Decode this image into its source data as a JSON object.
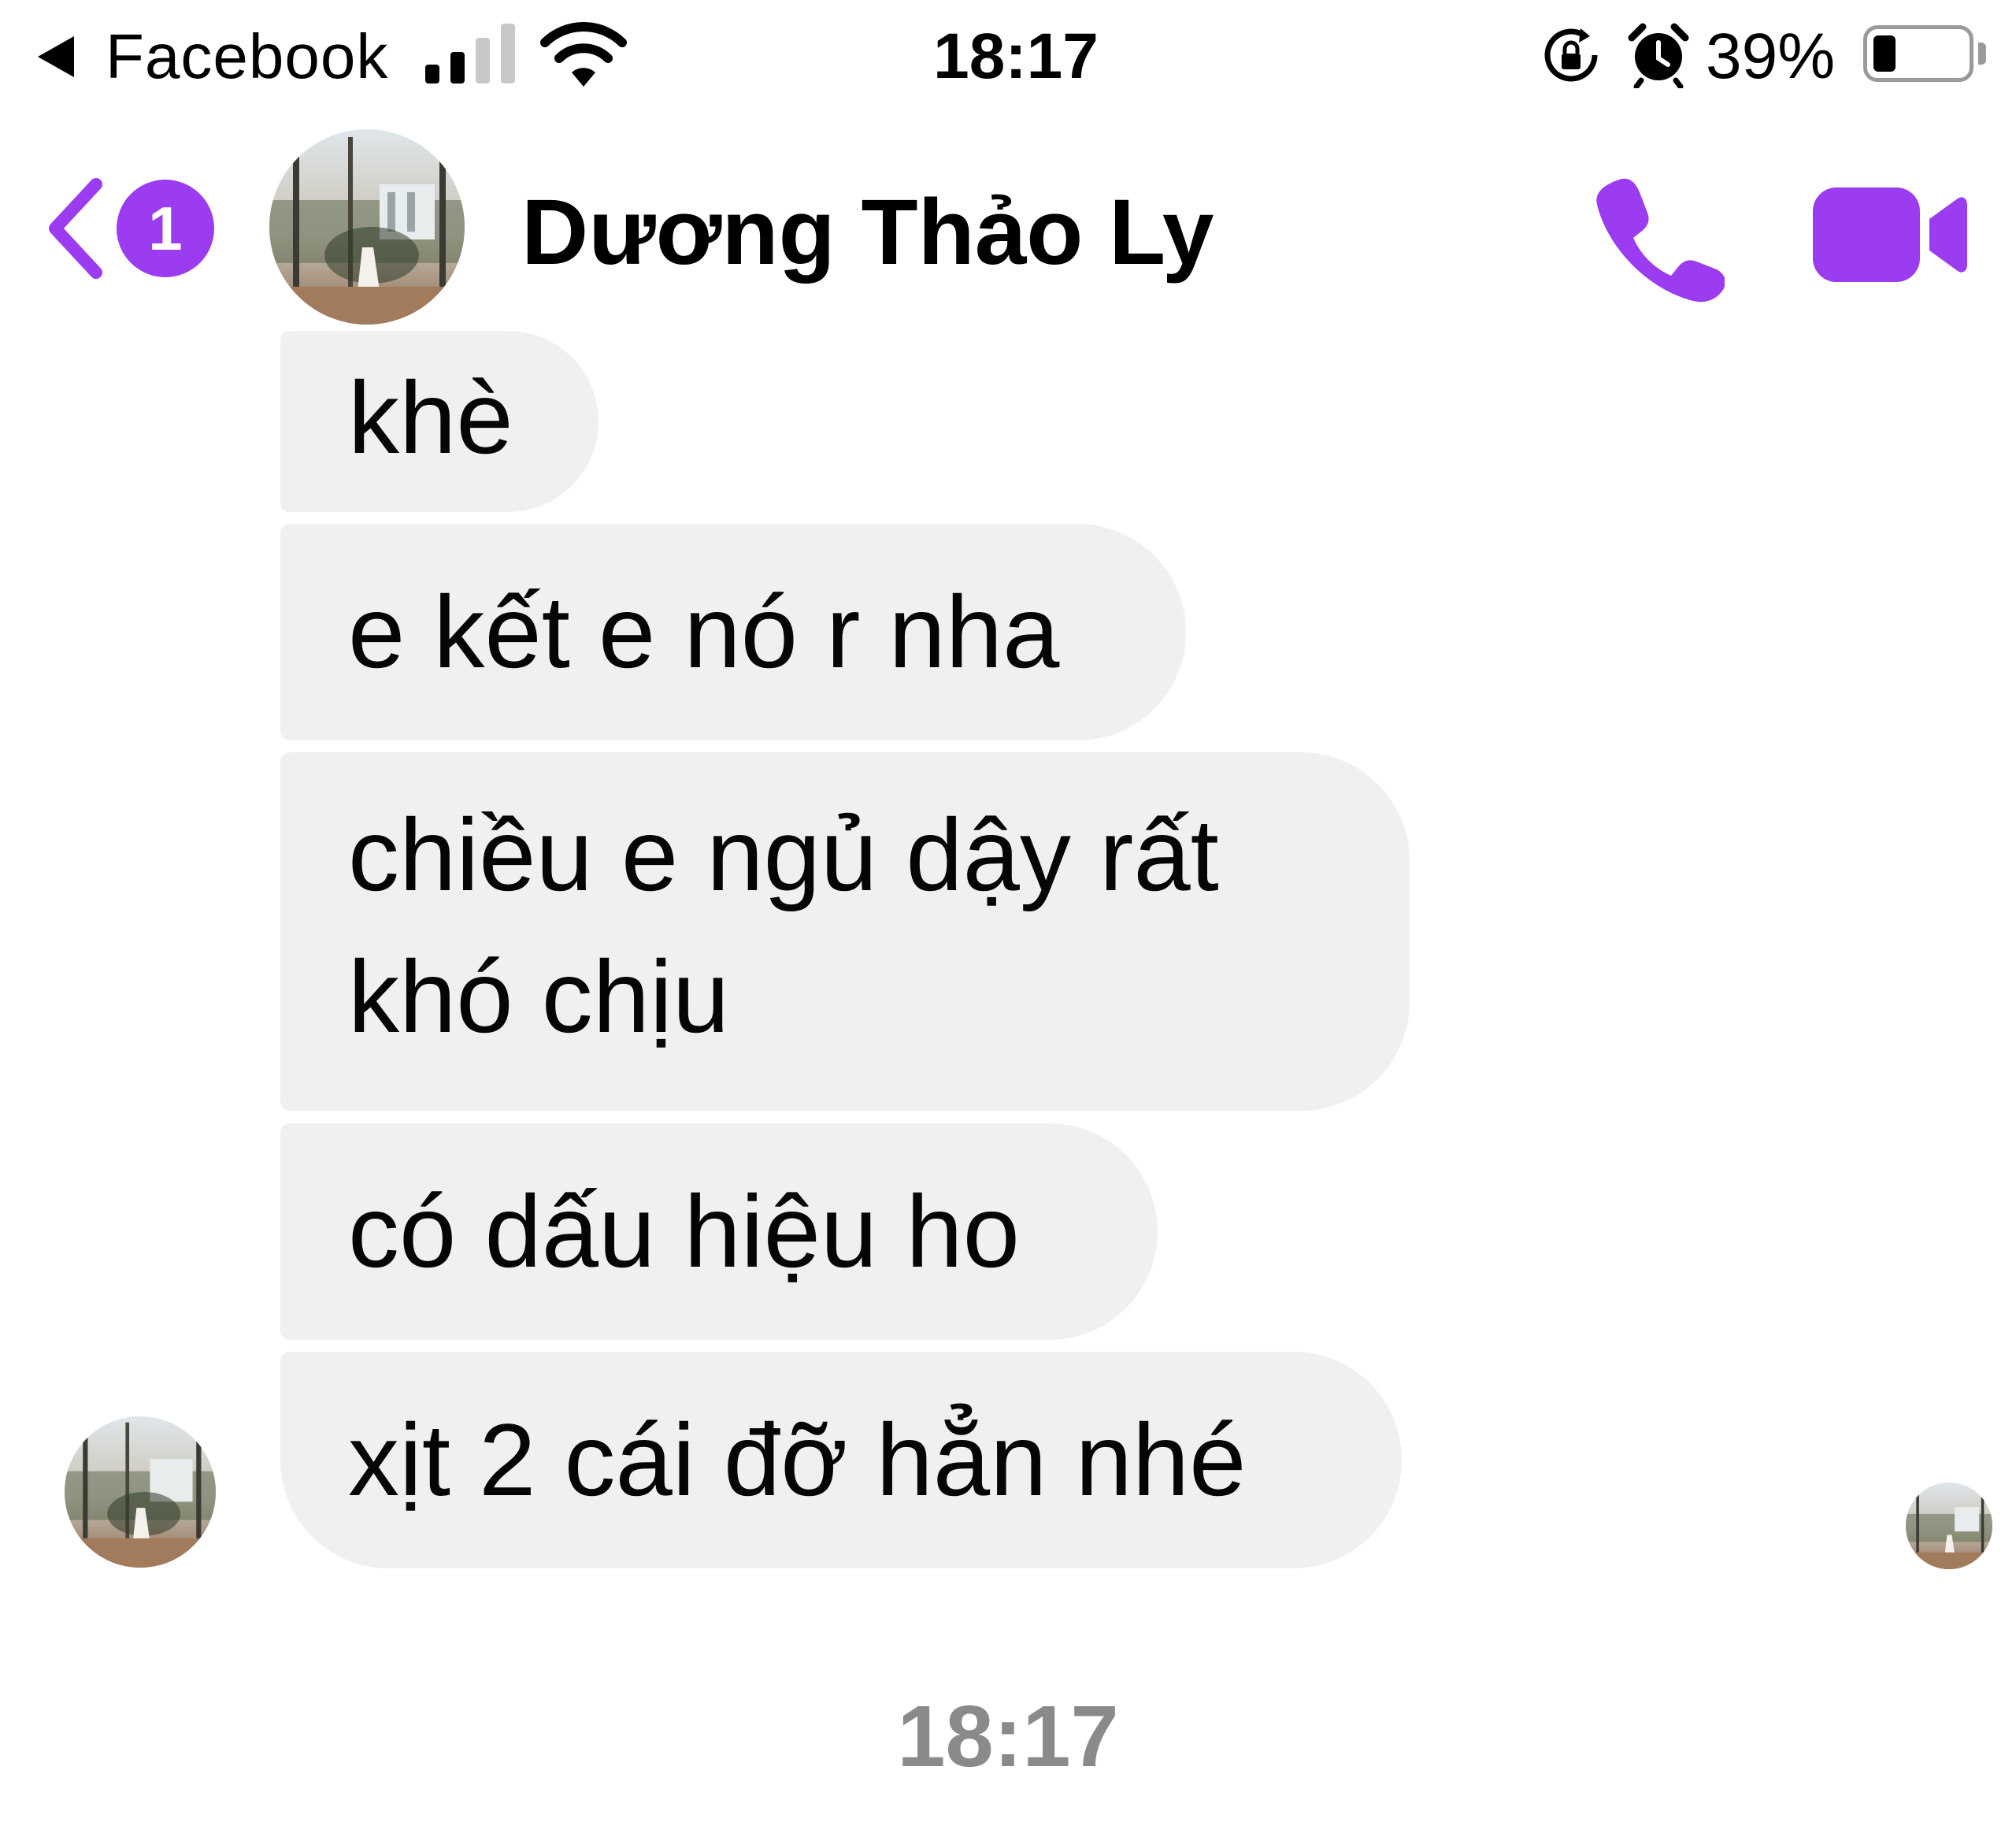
{
  "status_bar": {
    "back_app_label": "Facebook",
    "time": "18:17",
    "battery_percent_label": "39%",
    "battery_level": 0.39,
    "signal_bars_filled": 2,
    "signal_bars_total": 4,
    "icons": [
      "back-arrow-icon",
      "signal-icon",
      "wifi-icon",
      "orientation-lock-icon",
      "alarm-icon",
      "battery-icon"
    ]
  },
  "header": {
    "unread_count": "1",
    "contact_name": "Dương Thảo Ly",
    "icons": [
      "chevron-left-icon",
      "phone-icon",
      "video-camera-icon"
    ],
    "accent_color": "#9b3cf0"
  },
  "messages": [
    {
      "text": "khè"
    },
    {
      "text": "e kết e nó r nha"
    },
    {
      "text": "chiều e ngủ dậy rất khó chịu"
    },
    {
      "text": "có dấu hiệu ho"
    },
    {
      "text": "xịt 2 cái đỡ hẳn nhé"
    }
  ],
  "timestamp": "18:17",
  "colors": {
    "bubble_background": "#f0f0f0",
    "timestamp_text": "#8a8a8a"
  }
}
